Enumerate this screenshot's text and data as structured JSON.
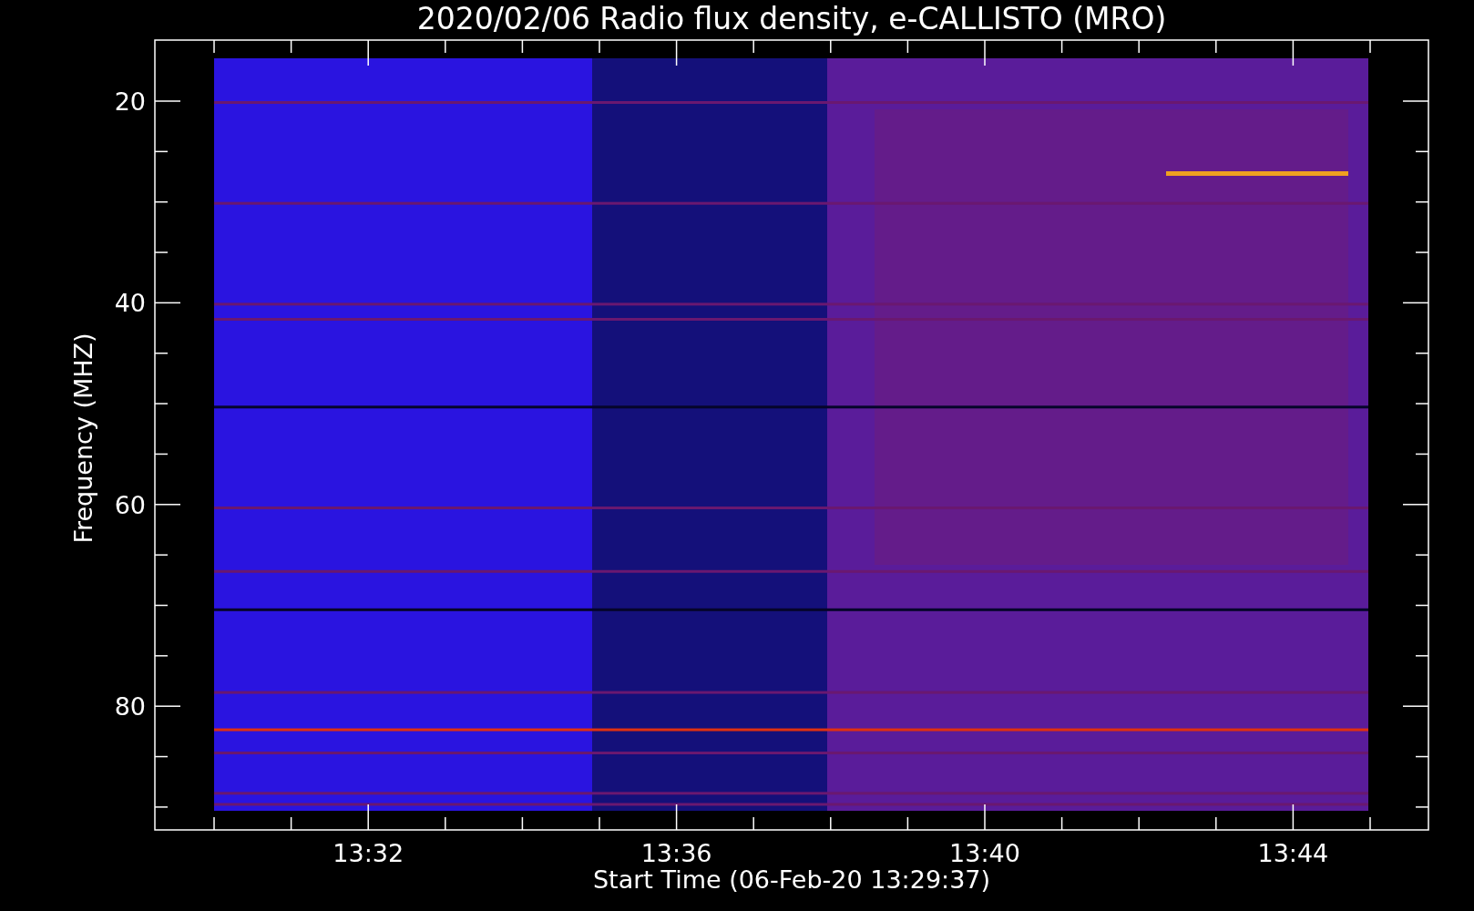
{
  "title": "2020/02/06  Radio flux density, e-CALLISTO (MRO)",
  "ylabel": "Frequency (MHZ)",
  "xlabel": "Start Time (06-Feb-20 13:29:37)",
  "yticks": [
    "20",
    "40",
    "60",
    "80"
  ],
  "xticks": [
    "13:32",
    "13:36",
    "13:40",
    "13:44"
  ]
}
